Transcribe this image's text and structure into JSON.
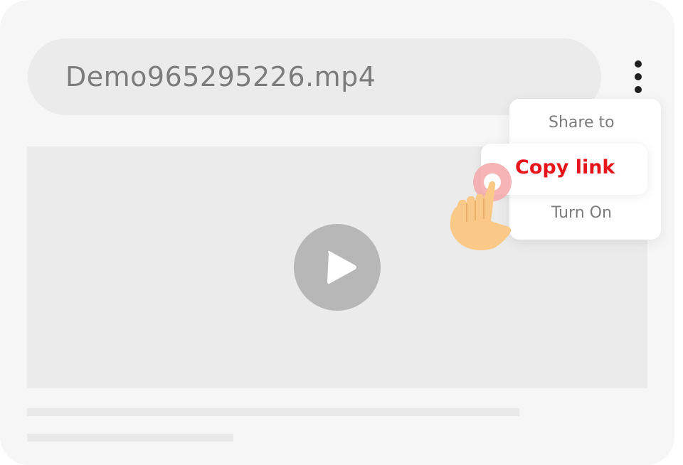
{
  "file": {
    "name": "Demo965295226.mp4"
  },
  "menu": {
    "items": [
      {
        "label": "Share to",
        "state": "normal"
      },
      {
        "label": "Copy link",
        "state": "highlighted"
      },
      {
        "label": "Turn On",
        "state": "normal"
      }
    ]
  },
  "icons": {
    "more": "more-vertical-icon",
    "play": "play-icon",
    "pointer": "hand-pointer-icon"
  },
  "colors": {
    "card_background": "#f6f6f6",
    "bar_background": "#ebebeb",
    "highlight_text": "#e8141c",
    "menu_text": "#7c7c7c",
    "play_button": "#b7b7b7",
    "tap_indicator": "#f4a7aa",
    "hand": "#fbc987"
  }
}
